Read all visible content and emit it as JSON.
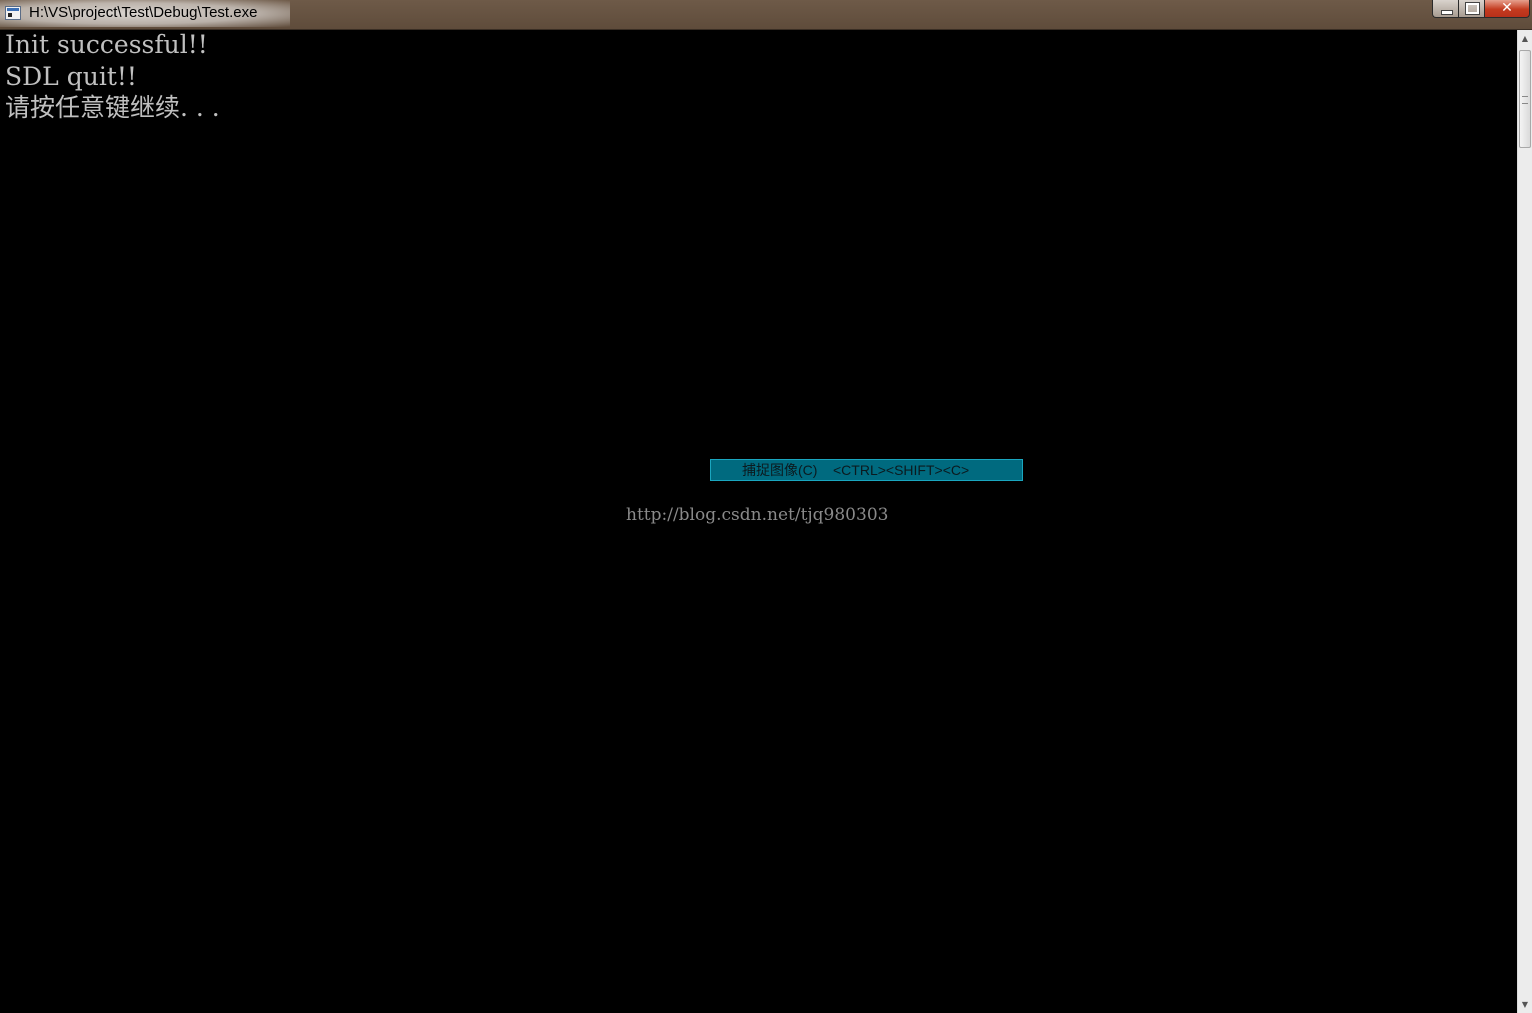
{
  "window": {
    "title": "H:\\VS\\project\\Test\\Debug\\Test.exe",
    "close_glyph": "✕"
  },
  "console": {
    "lines": [
      "Init successful!!",
      "SDL quit!!",
      "请按任意键继续. . ."
    ]
  },
  "overlay": {
    "capture_hint": "捕捉图像(C)    <CTRL><SHIFT><C>"
  },
  "watermark": {
    "text": "http://blog.csdn.net/tjq980303"
  },
  "scrollbar": {
    "up_glyph": "▲",
    "down_glyph": "▼"
  },
  "colors": {
    "console_bg": "#000000",
    "console_text": "#c0c0c0",
    "titlebar": "#6e5a48",
    "tooltip_bg": "#006a7f"
  }
}
